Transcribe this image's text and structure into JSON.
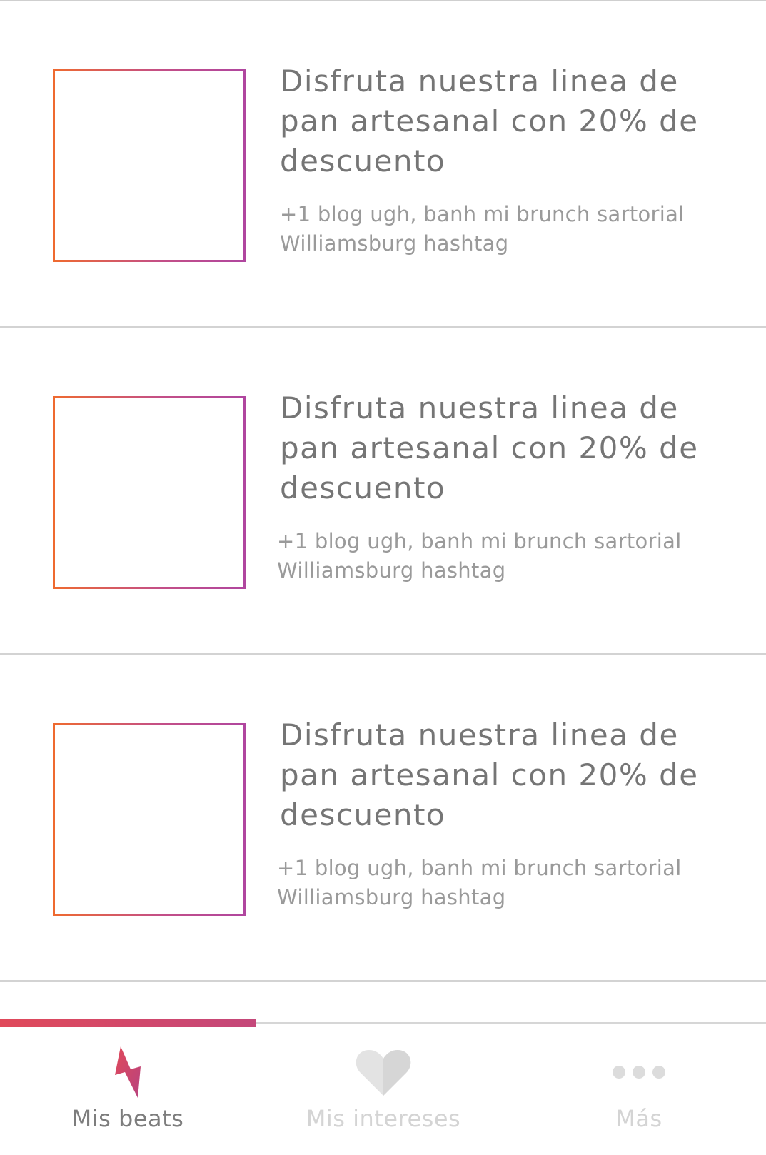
{
  "feed": {
    "items": [
      {
        "title": "Disfruta nuestra linea de pan artesanal con 20% de descuento",
        "description": "+1 blog ugh, banh mi brunch sartorial Williamsburg hashtag"
      },
      {
        "title": "Disfruta nuestra linea de pan artesanal con 20% de descuento",
        "description": "+1 blog ugh, banh mi brunch sartorial Williamsburg hashtag"
      },
      {
        "title": "Disfruta nuestra linea de pan artesanal con 20% de descuento",
        "description": "+1 blog ugh, banh mi brunch sartorial Williamsburg hashtag"
      }
    ]
  },
  "tabbar": {
    "tabs": [
      {
        "label": "Mis beats",
        "icon": "lightning-icon",
        "active": true
      },
      {
        "label": "Mis intereses",
        "icon": "heart-icon",
        "active": false
      },
      {
        "label": "Más",
        "icon": "more-dots-icon",
        "active": false
      }
    ],
    "colors": {
      "accent_start": "#e0495a",
      "accent_end": "#c4487a",
      "thumb_border_start": "#ef6a2f",
      "thumb_border_end": "#b0469f",
      "inactive": "#d4d4d4"
    }
  }
}
